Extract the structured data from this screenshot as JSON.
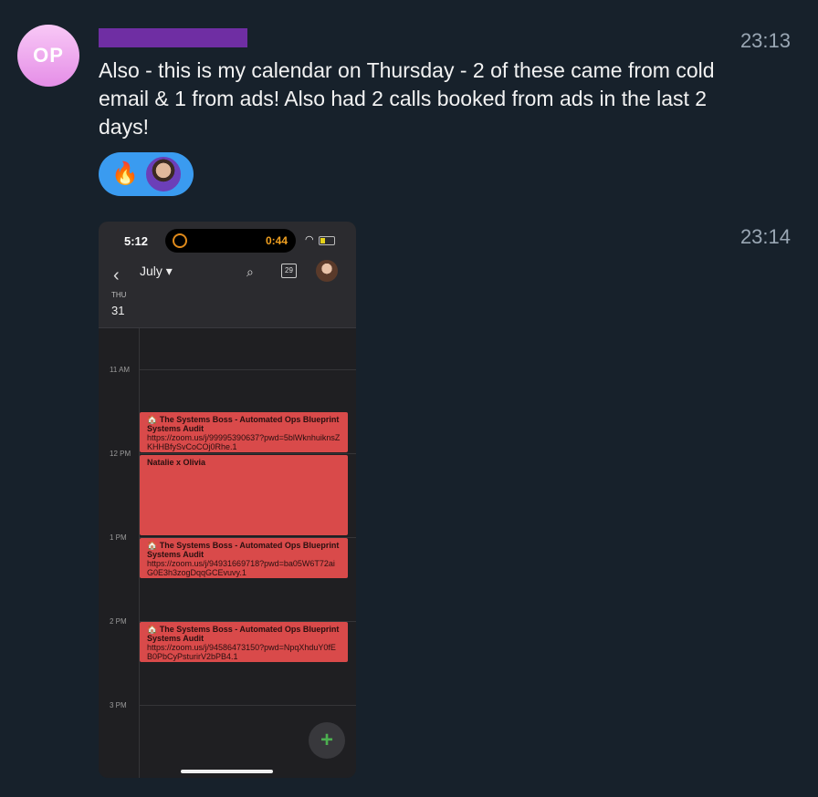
{
  "sender": {
    "initials": "OP"
  },
  "messages": [
    {
      "time": "23:13",
      "text": "Also - this is my calendar on Thursday - 2 of these came from cold email & 1 from ads! Also had 2 calls booked from ads in the last 2 days!"
    },
    {
      "time": "23:14"
    }
  ],
  "reaction": {
    "emoji": "🔥"
  },
  "phone": {
    "clock": "5:12",
    "timer": "0:44",
    "month": "July",
    "day_of_week": "THU",
    "day_number": "31",
    "calendar_icon_day": "29",
    "hours": [
      "11 AM",
      "12 PM",
      "1 PM",
      "2 PM",
      "3 PM"
    ],
    "events": [
      {
        "title": "🏠 The Systems Boss - Automated Ops Blueprint Systems Audit",
        "detail": "https://zoom.us/j/99995390637?pwd=5blWknhuiknsZKHHBfySvCoCOj0Rhe.1"
      },
      {
        "title": "Natalie x Olivia",
        "detail": ""
      },
      {
        "title": "🏠 The Systems Boss - Automated Ops Blueprint Systems Audit",
        "detail": "https://zoom.us/j/94931669718?pwd=ba05W6T72aiG0E3h3zogDqqGCEvuvy.1"
      },
      {
        "title": "🏠 The Systems Boss - Automated Ops Blueprint Systems Audit",
        "detail": "https://zoom.us/j/94586473150?pwd=NpqXhduY0fEB0PbCyPsturirV2bPB4.1"
      }
    ],
    "fab_label": "+"
  }
}
